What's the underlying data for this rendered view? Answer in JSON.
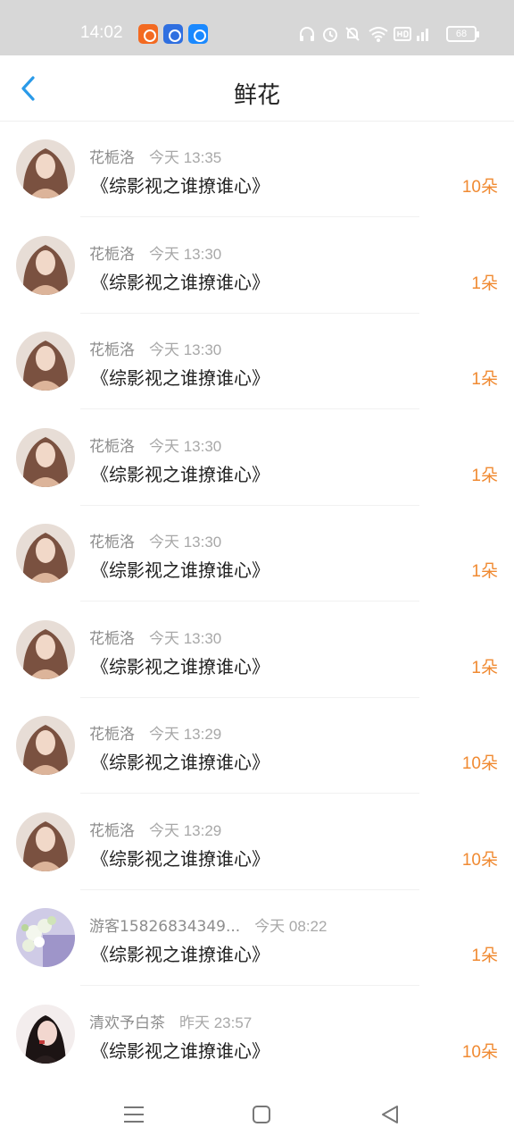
{
  "status_bar": {
    "time": "14:02",
    "battery": "68",
    "icons": [
      "orange-app-icon",
      "baidu-icon",
      "blue-app-icon",
      "headphones-icon",
      "alarm-icon",
      "mute-icon",
      "wifi-icon",
      "hd-icon",
      "4g-signal-icon",
      "battery-icon"
    ]
  },
  "header": {
    "title": "鲜花",
    "back_icon": "chevron-left-icon",
    "accent_color": "#2a9ae8"
  },
  "items": [
    {
      "name": "花栀洛",
      "time": "今天 13:35",
      "book": "《综影视之谁撩谁心》",
      "amount": "10朵",
      "avatar": "girl"
    },
    {
      "name": "花栀洛",
      "time": "今天 13:30",
      "book": "《综影视之谁撩谁心》",
      "amount": "1朵",
      "avatar": "girl"
    },
    {
      "name": "花栀洛",
      "time": "今天 13:30",
      "book": "《综影视之谁撩谁心》",
      "amount": "1朵",
      "avatar": "girl"
    },
    {
      "name": "花栀洛",
      "time": "今天 13:30",
      "book": "《综影视之谁撩谁心》",
      "amount": "1朵",
      "avatar": "girl"
    },
    {
      "name": "花栀洛",
      "time": "今天 13:30",
      "book": "《综影视之谁撩谁心》",
      "amount": "1朵",
      "avatar": "girl"
    },
    {
      "name": "花栀洛",
      "time": "今天 13:30",
      "book": "《综影视之谁撩谁心》",
      "amount": "1朵",
      "avatar": "girl"
    },
    {
      "name": "花栀洛",
      "time": "今天 13:29",
      "book": "《综影视之谁撩谁心》",
      "amount": "10朵",
      "avatar": "girl"
    },
    {
      "name": "花栀洛",
      "time": "今天 13:29",
      "book": "《综影视之谁撩谁心》",
      "amount": "10朵",
      "avatar": "girl"
    },
    {
      "name": "游客15826834349...",
      "time": "今天 08:22",
      "book": "《综影视之谁撩谁心》",
      "amount": "1朵",
      "avatar": "flowers"
    },
    {
      "name": "清欢予白茶",
      "time": "昨天 23:57",
      "book": "《综影视之谁撩谁心》",
      "amount": "10朵",
      "avatar": "portrait"
    }
  ],
  "amount_color": "#f08a32",
  "nav_bar": {
    "icons": [
      "menu-icon",
      "home-square-icon",
      "back-triangle-icon"
    ]
  }
}
